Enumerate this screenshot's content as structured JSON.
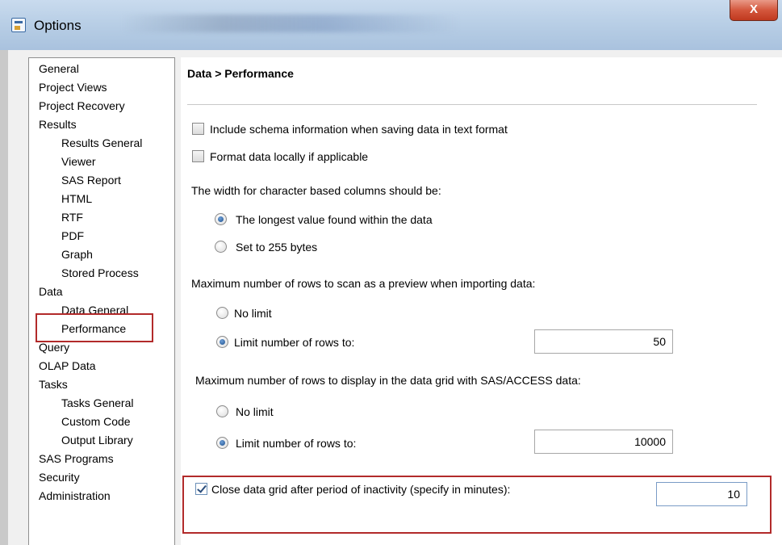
{
  "window": {
    "title": "Options",
    "close_label": "X"
  },
  "nav": {
    "items": [
      {
        "label": "General"
      },
      {
        "label": "Project Views"
      },
      {
        "label": "Project Recovery"
      },
      {
        "label": "Results"
      },
      {
        "label": "Results General"
      },
      {
        "label": "Viewer"
      },
      {
        "label": "SAS Report"
      },
      {
        "label": "HTML"
      },
      {
        "label": "RTF"
      },
      {
        "label": "PDF"
      },
      {
        "label": "Graph"
      },
      {
        "label": "Stored Process"
      },
      {
        "label": "Data"
      },
      {
        "label": "Data General"
      },
      {
        "label": "Performance"
      },
      {
        "label": "Query"
      },
      {
        "label": "OLAP Data"
      },
      {
        "label": "Tasks"
      },
      {
        "label": "Tasks General"
      },
      {
        "label": "Custom Code"
      },
      {
        "label": "Output Library"
      },
      {
        "label": "SAS Programs"
      },
      {
        "label": "Security"
      },
      {
        "label": "Administration"
      }
    ],
    "selected": "Performance"
  },
  "panel": {
    "title": "Data > Performance",
    "include_schema": {
      "label": "Include schema information when saving data in text format",
      "checked": false
    },
    "format_locally": {
      "label": "Format data locally if applicable",
      "checked": false
    },
    "width_heading": "The width for character based columns should be:",
    "width_longest": {
      "label": "The longest value found within the data",
      "selected": true
    },
    "width_255": {
      "label": "Set to 255 bytes",
      "selected": false
    },
    "preview_heading": "Maximum number of rows to scan as a preview when importing data:",
    "preview_no_limit": {
      "label": "No limit",
      "selected": false
    },
    "preview_limit": {
      "label": "Limit number of rows to:",
      "selected": true,
      "value": "50"
    },
    "grid_heading": "Maximum number of rows to display in the data grid with SAS/ACCESS data:",
    "grid_no_limit": {
      "label": "No limit",
      "selected": false
    },
    "grid_limit": {
      "label": "Limit number of rows to:",
      "selected": true,
      "value": "10000"
    },
    "close_grid": {
      "label": "Close data grid after period of inactivity (specify in minutes):",
      "checked": true,
      "value": "10"
    }
  },
  "colors": {
    "highlight": "#b22a2a",
    "titlebar": "#b9cfe6"
  }
}
